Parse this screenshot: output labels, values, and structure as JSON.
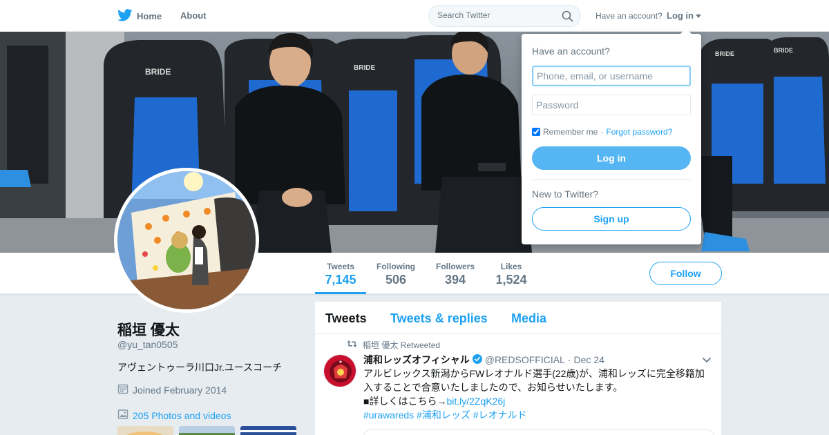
{
  "nav": {
    "home_label": "Home",
    "about_label": "About",
    "search_placeholder": "Search Twitter",
    "have_account": "Have an account?",
    "login_label": "Log in"
  },
  "login_dropdown": {
    "title": "Have an account?",
    "username_placeholder": "Phone, email, or username",
    "password_placeholder": "Password",
    "remember_me": "Remember me",
    "separator": " · ",
    "forgot_password": "Forgot password?",
    "login_button": "Log in",
    "new_to_twitter": "New to Twitter?",
    "signup_button": "Sign up"
  },
  "stats": [
    {
      "label": "Tweets",
      "value": "7,145",
      "active": true
    },
    {
      "label": "Following",
      "value": "506"
    },
    {
      "label": "Followers",
      "value": "394"
    },
    {
      "label": "Likes",
      "value": "1,524"
    }
  ],
  "follow_button": "Follow",
  "profile": {
    "name": "稲垣 優太",
    "handle": "@yu_tan0505",
    "bio": "アヴェントゥーラ川口Jr.ユースコーチ",
    "joined": "Joined February 2014",
    "photos": "205 Photos and videos"
  },
  "timeline": {
    "tabs": [
      "Tweets",
      "Tweets & replies",
      "Media"
    ],
    "tweet": {
      "retweeted_by": "稲垣 優太 Retweeted",
      "author_name": "浦和レッズオフィシャル",
      "author_handle": "@REDSOFFICIAL",
      "dot": "·",
      "date": "Dec 24",
      "text_line1": "アルビレックス新潟からFWレオナルド選手(22歳)が、浦和レッズに完全移籍加入することで合意いたしましたので、お知らせいたします。",
      "text_line2": "■詳しくはこちら→",
      "link": "bit.ly/2ZqK26j",
      "hashtags": "#urawareds #浦和レッズ #レオナルド"
    }
  },
  "colors": {
    "brand": "#1da1f2",
    "background": "#e6ecf0",
    "login_button": "#55b6f3"
  }
}
